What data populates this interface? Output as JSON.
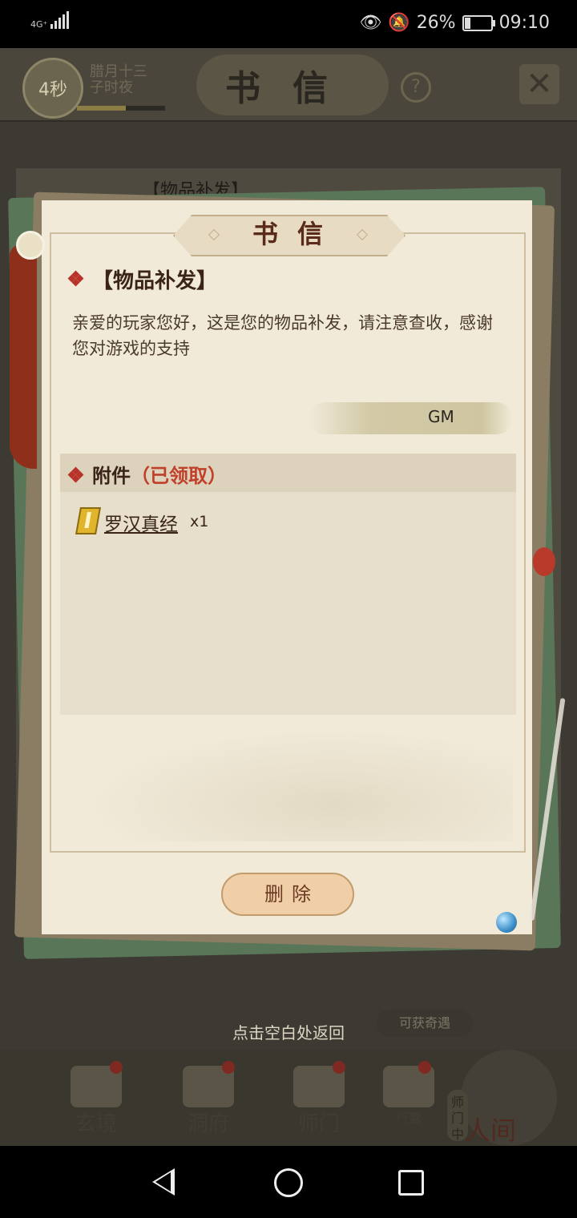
{
  "status_bar": {
    "network_type": "4G⁺",
    "battery_percent": "26%",
    "battery_level": 0.26,
    "time": "09:10"
  },
  "game": {
    "countdown": "4秒",
    "countdown_progress": 0.55,
    "date_line1": "腊月十三",
    "date_line2": "子时夜",
    "screen_title": "书信",
    "help_symbol": "?",
    "bg_mail_subject": "【物品补发】",
    "return_hint": "点击空白处返回",
    "adventure_label": "可获奇遇",
    "shimen_tag": "师门中",
    "dock": [
      {
        "label": "玄境"
      },
      {
        "label": "洞府"
      },
      {
        "label": "师门"
      },
      {
        "label": "行囊"
      },
      {
        "label": "人间"
      }
    ]
  },
  "dialog": {
    "title": "书信",
    "subject": "【物品补发】",
    "body": "亲爱的玩家您好，这是您的物品补发，请注意查收，感谢您对游戏的支持",
    "sender": "GM",
    "attachments_label": "附件",
    "attachments_status": "（已领取）",
    "items": [
      {
        "name": "罗汉真经",
        "qty": "x1",
        "icon": "book-icon"
      }
    ],
    "delete_label": "删除"
  },
  "colors": {
    "paper": "#f1ead9",
    "accent_red": "#c0402a",
    "ink": "#3a2418",
    "button": "#f0cfa8"
  }
}
